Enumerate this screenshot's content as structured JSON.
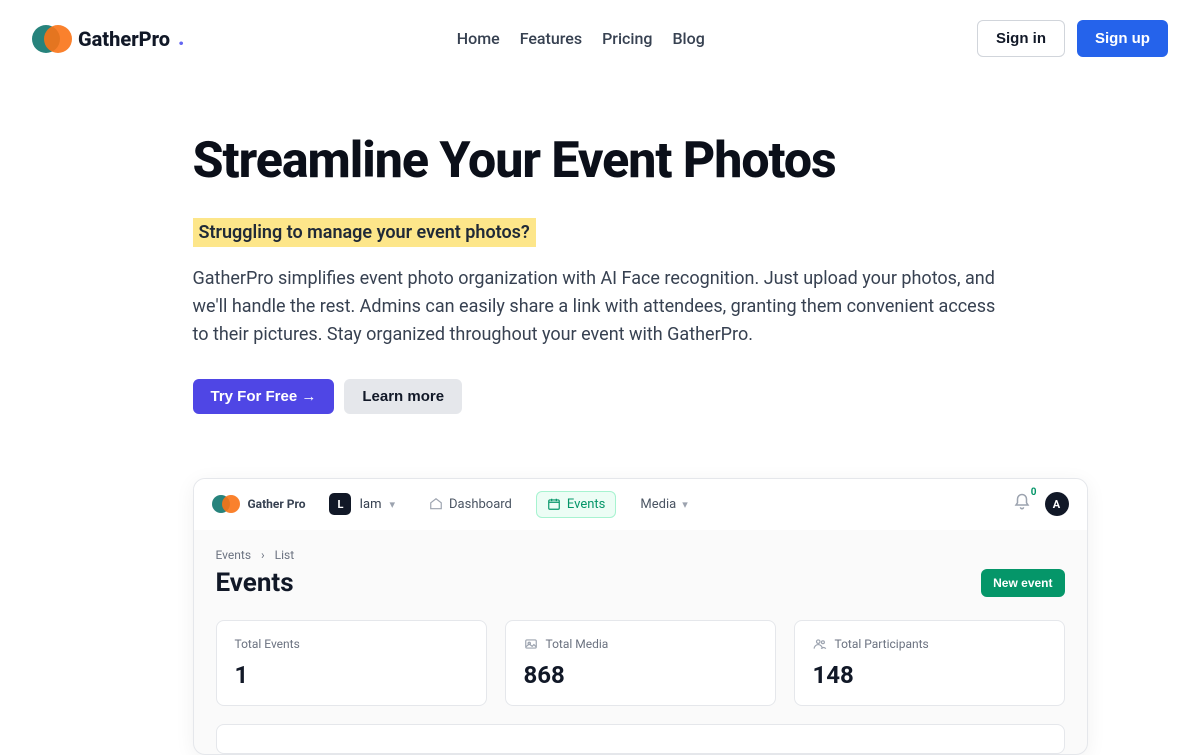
{
  "brand": {
    "name": "GatherPro",
    "dot": "."
  },
  "nav": {
    "home": "Home",
    "features": "Features",
    "pricing": "Pricing",
    "blog": "Blog"
  },
  "auth": {
    "signin": "Sign in",
    "signup": "Sign up"
  },
  "hero": {
    "title": "Streamline Your Event Photos",
    "highlight": "Struggling to manage your event photos?",
    "desc": "GatherPro simplifies event photo organization with AI Face recognition. Just upload your photos, and we'll handle the rest. Admins can easily share a link with attendees, granting them convenient access to their pictures. Stay organized throughout your event with GatherPro.",
    "cta_primary": "Try For Free →",
    "cta_secondary": "Learn more"
  },
  "app": {
    "brand": "Gather Pro",
    "workspace": {
      "letter": "L",
      "name": "Iam"
    },
    "nav": {
      "dashboard": "Dashboard",
      "events": "Events",
      "media": "Media"
    },
    "notif_count": "0",
    "avatar_letter": "A",
    "breadcrumb": {
      "root": "Events",
      "sep": "›",
      "leaf": "List"
    },
    "title": "Events",
    "new_event": "New event",
    "stats": {
      "events": {
        "label": "Total Events",
        "value": "1"
      },
      "media": {
        "label": "Total Media",
        "value": "868"
      },
      "participants": {
        "label": "Total Participants",
        "value": "148"
      }
    }
  }
}
